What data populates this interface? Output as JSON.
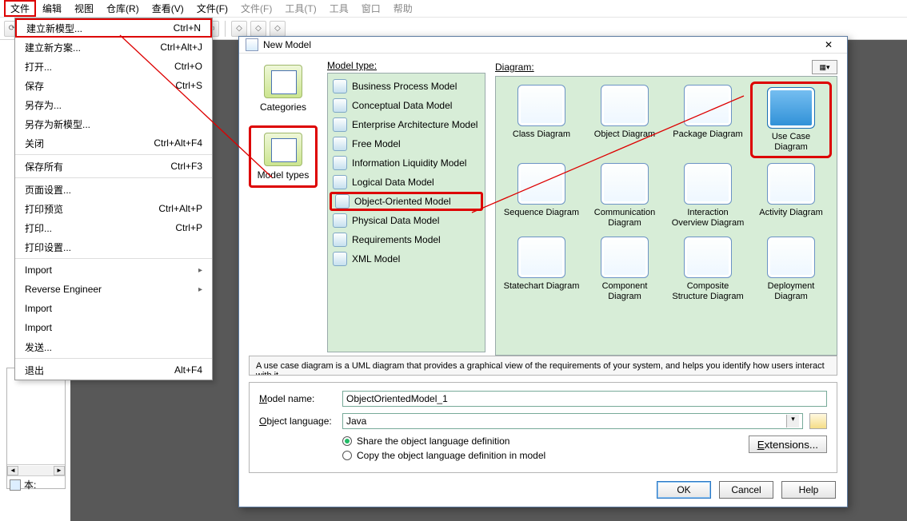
{
  "menubar": {
    "primary": [
      "文件",
      "编辑",
      "视图",
      "仓库(R)",
      "查看(V)",
      "文件(F)"
    ],
    "secondary": [
      "文件(F)",
      "工具(T)",
      "工具",
      "窗口",
      "帮助"
    ]
  },
  "file_menu": [
    {
      "label": "建立新模型...",
      "accel": "Ctrl+N",
      "hl": true
    },
    {
      "label": "建立新方案...",
      "accel": "Ctrl+Alt+J"
    },
    {
      "label": "打开...",
      "accel": "Ctrl+O"
    },
    {
      "label": "保存",
      "accel": "Ctrl+S"
    },
    {
      "label": "另存为..."
    },
    {
      "label": "另存为新模型..."
    },
    {
      "label": "关闭",
      "accel": "Ctrl+Alt+F4"
    },
    {
      "sep": true
    },
    {
      "label": "保存所有",
      "accel": "Ctrl+F3"
    },
    {
      "sep": true
    },
    {
      "label": "页面设置..."
    },
    {
      "label": "打印预览",
      "accel": "Ctrl+Alt+P"
    },
    {
      "label": "打印...",
      "accel": "Ctrl+P"
    },
    {
      "label": "打印设置..."
    },
    {
      "sep": true
    },
    {
      "label": "Import",
      "arrow": true
    },
    {
      "label": "Reverse Engineer",
      "arrow": true
    },
    {
      "label": "Import"
    },
    {
      "label": "Import"
    },
    {
      "label": "发送..."
    },
    {
      "sep": true
    },
    {
      "label": "退出",
      "accel": "Alt+F4"
    }
  ],
  "thumb_footer": "本:",
  "dialog": {
    "title": "New Model",
    "cat_label": "Categories",
    "mt_label": "Model types",
    "list_header": "Model type:",
    "diag_header": "Diagram:",
    "model_types": [
      "Business Process Model",
      "Conceptual Data Model",
      "Enterprise Architecture Model",
      "Free Model",
      "Information Liquidity Model",
      "Logical Data Model",
      "Object-Oriented Model",
      "Physical Data Model",
      "Requirements Model",
      "XML Model"
    ],
    "diagrams": [
      "Class Diagram",
      "Object Diagram",
      "Package Diagram",
      "Use Case Diagram",
      "Sequence Diagram",
      "Communication Diagram",
      "Interaction Overview Diagram",
      "Activity Diagram",
      "Statechart Diagram",
      "Component Diagram",
      "Composite Structure Diagram",
      "Deployment Diagram"
    ],
    "description": "A use case diagram is a UML diagram that provides a graphical view of the requirements of your system, and helps you identify how users interact with it.",
    "form": {
      "name_label": "Model name:",
      "name_value": "ObjectOrientedModel_1",
      "lang_label": "Object language:",
      "lang_value": "Java",
      "radio_share": "Share the object language definition",
      "radio_copy": "Copy the object language definition in model",
      "extensions": "Extensions..."
    },
    "buttons": {
      "ok": "OK",
      "cancel": "Cancel",
      "help": "Help"
    }
  }
}
